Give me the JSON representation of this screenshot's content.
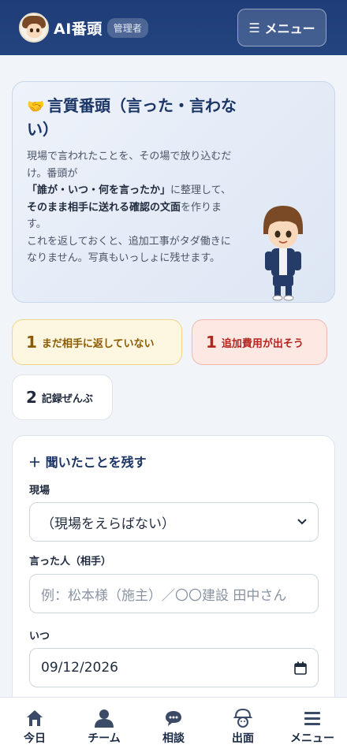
{
  "header": {
    "title": "AI番頭",
    "role_badge": "管理者",
    "menu_label": "メニュー"
  },
  "intro": {
    "icon": "🤝",
    "title": "言質番頭（言った・言わない）",
    "body_part1": "現場で言われたことを、その場で放り込むだけ。番頭が",
    "body_bold1": "「誰が・いつ・何を言ったか」",
    "body_part2": "に整理して、",
    "body_bold2": "そのまま相手に送れる確認の文面",
    "body_part3": "を作ります。",
    "body_part4": "これを返しておくと、追加工事がタダ働きになりません。写真もいっしょに残せます。"
  },
  "stats": [
    {
      "count": "1",
      "label": "まだ相手に返していない"
    },
    {
      "count": "1",
      "label": "追加費用が出そう"
    },
    {
      "count": "2",
      "label": "記録ぜんぶ"
    }
  ],
  "form": {
    "heading": "＋ 聞いたことを残す",
    "site_label": "現場",
    "site_value": "（現場をえらばない）",
    "speaker_label": "言った人（相手）",
    "speaker_placeholder": "例：松本様（施主）／〇〇建設 田中さん",
    "when_label": "いつ",
    "when_value": "09/12/2026"
  },
  "nav": [
    {
      "label": "今日",
      "icon": "house-icon"
    },
    {
      "label": "チーム",
      "icon": "person-icon"
    },
    {
      "label": "相談",
      "icon": "chat-icon"
    },
    {
      "label": "出面",
      "icon": "helmet-icon"
    },
    {
      "label": "メニュー",
      "icon": "menu-icon"
    }
  ]
}
